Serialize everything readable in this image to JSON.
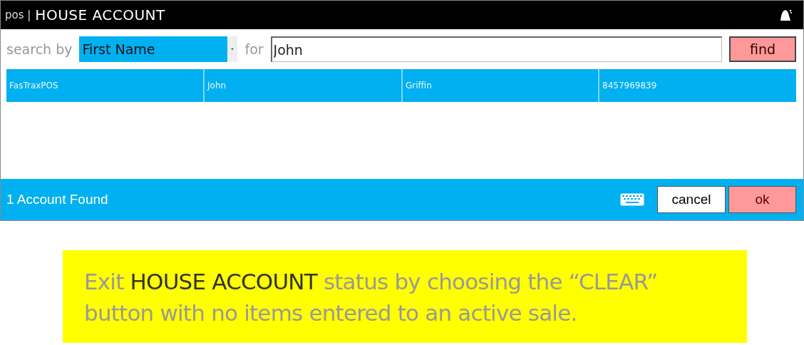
{
  "window": {
    "app": "pos |",
    "title": "HOUSE ACCOUNT"
  },
  "search": {
    "label": "search by",
    "field": "First Name",
    "for_label": "for",
    "value": "John",
    "button": "find"
  },
  "results": {
    "rows": [
      {
        "cells": [
          "FasTraxPOS",
          "John",
          "Griffin",
          "8457969839"
        ],
        "selected": true
      }
    ]
  },
  "status_bar": {
    "text": "1 Account Found",
    "buttons": [
      {
        "label": "cancel",
        "kind": "plain"
      },
      {
        "label": "ok",
        "kind": "primary"
      }
    ]
  },
  "caption": "Exit **HOUSE ACCOUNT** status by choosing the “CLEAR” button with no items entered to an active sale."
}
